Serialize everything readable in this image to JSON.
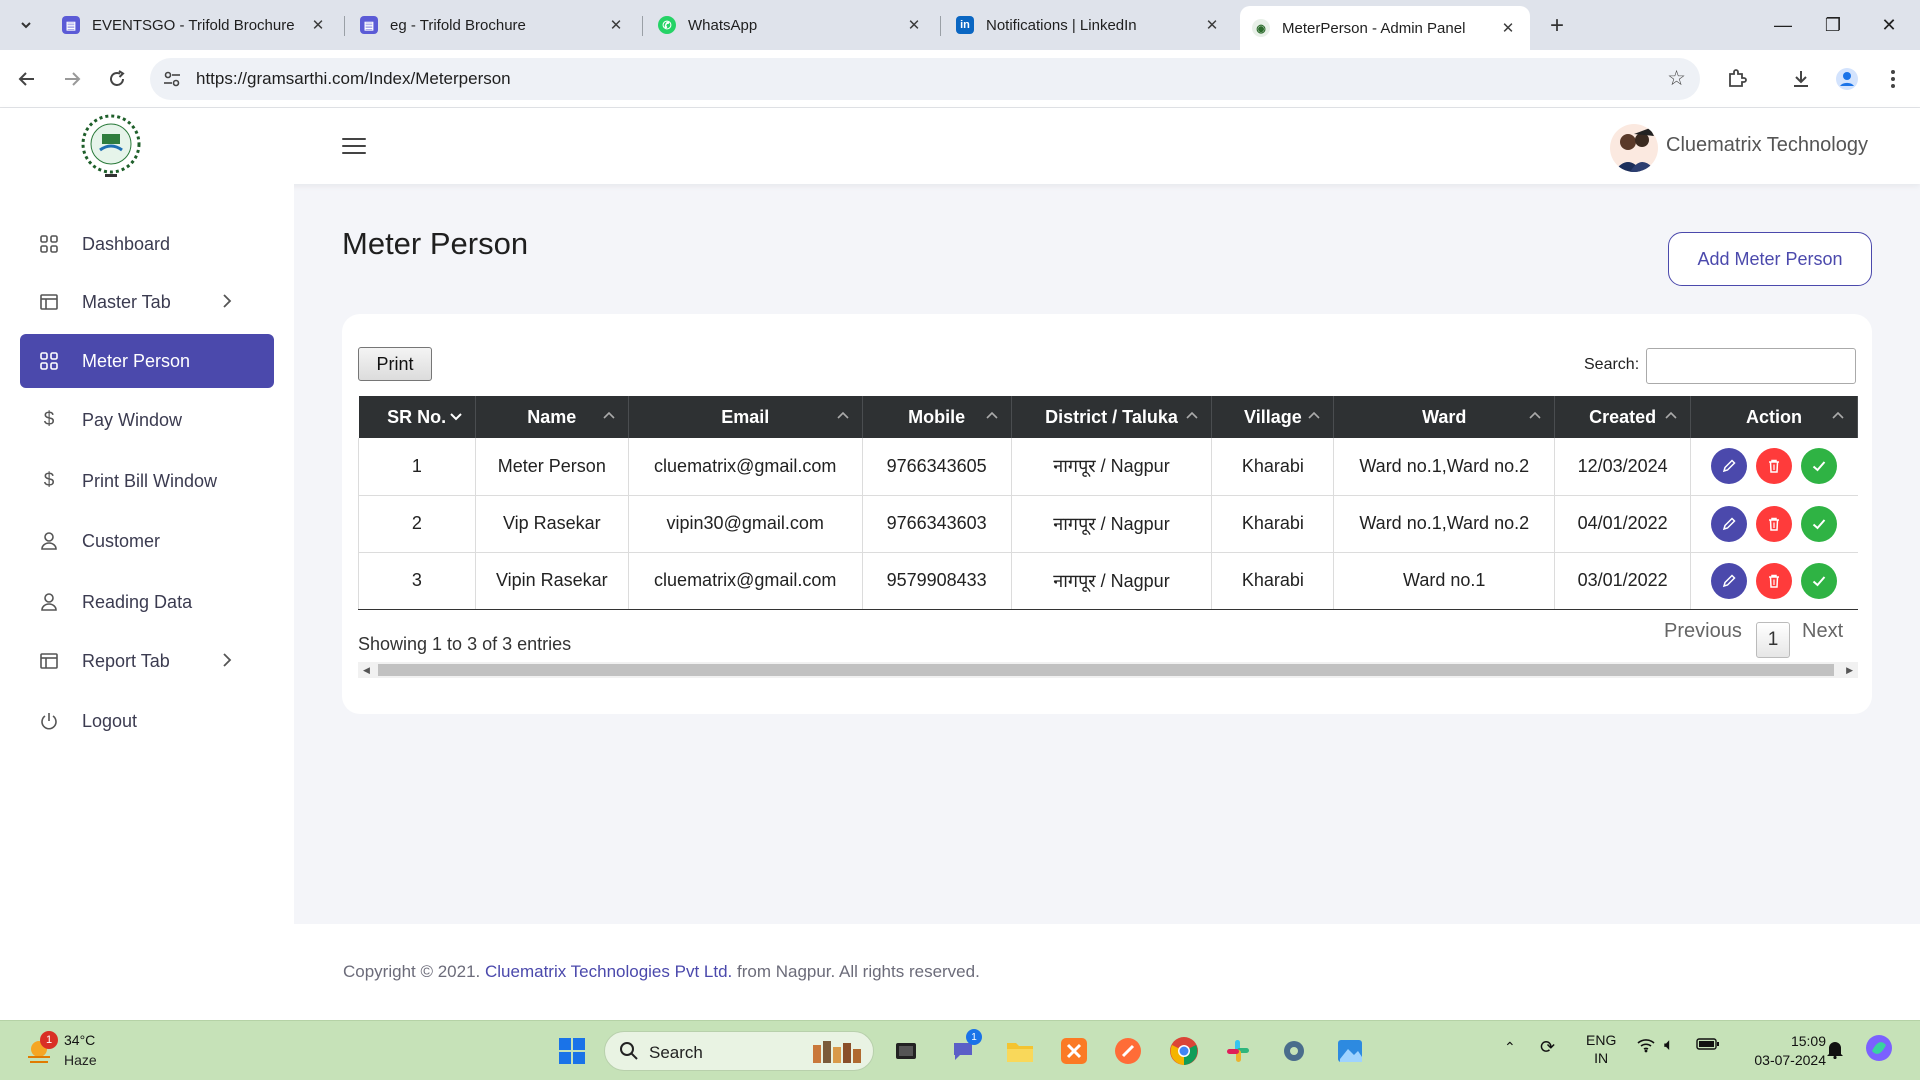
{
  "browser": {
    "tabs": [
      {
        "label": "EVENTSGO - Trifold Brochure"
      },
      {
        "label": "eg - Trifold Brochure"
      },
      {
        "label": "WhatsApp"
      },
      {
        "label": "Notifications | LinkedIn"
      },
      {
        "label": "MeterPerson - Admin Panel"
      }
    ],
    "url": "https://gramsarthi.com/Index/Meterperson"
  },
  "header": {
    "user_name": "Cluematrix Technology"
  },
  "sidebar": {
    "items": [
      {
        "label": "Dashboard",
        "icon": "grid-icon"
      },
      {
        "label": "Master Tab",
        "icon": "table-icon",
        "has_submenu": true
      },
      {
        "label": "Meter Person",
        "icon": "grid-icon",
        "active": true
      },
      {
        "label": "Pay Window",
        "icon": "dollar-icon"
      },
      {
        "label": "Print Bill Window",
        "icon": "dollar-icon"
      },
      {
        "label": "Customer",
        "icon": "user-icon"
      },
      {
        "label": "Reading Data",
        "icon": "user-icon"
      },
      {
        "label": "Report Tab",
        "icon": "table-icon",
        "has_submenu": true
      },
      {
        "label": "Logout",
        "icon": "power-icon"
      }
    ]
  },
  "main": {
    "title": "Meter Person",
    "add_button": "Add Meter Person",
    "print_button": "Print",
    "search_label": "Search:",
    "search_value": "",
    "table": {
      "headers": [
        "SR No.",
        "Name",
        "Email",
        "Mobile",
        "District / Taluka",
        "Village",
        "Ward",
        "Created",
        "Action"
      ],
      "rows": [
        {
          "sr": "1",
          "name": "Meter Person",
          "email": "cluematrix@gmail.com",
          "mobile": "9766343605",
          "district": "नागपूर / Nagpur",
          "village": "Kharabi",
          "ward": "Ward no.1,Ward no.2",
          "created": "12/03/2024"
        },
        {
          "sr": "2",
          "name": "Vip Rasekar",
          "email": "vipin30@gmail.com",
          "mobile": "9766343603",
          "district": "नागपूर / Nagpur",
          "village": "Kharabi",
          "ward": "Ward no.1,Ward no.2",
          "created": "04/01/2022"
        },
        {
          "sr": "3",
          "name": "Vipin Rasekar",
          "email": "cluematrix@gmail.com",
          "mobile": "9579908433",
          "district": "नागपूर / Nagpur",
          "village": "Kharabi",
          "ward": "Ward no.1",
          "created": "03/01/2022"
        }
      ]
    },
    "info": "Showing 1 to 3 of 3 entries",
    "pagination": {
      "previous": "Previous",
      "current": "1",
      "next": "Next"
    }
  },
  "footer": {
    "prefix": "Copyright © 2021. ",
    "link": "Cluematrix Technologies Pvt Ltd.",
    "suffix": " from Nagpur. All rights reserved."
  },
  "taskbar": {
    "weather_temp": "34°C",
    "weather_cond": "Haze",
    "weather_badge": "1",
    "search_label": "Search",
    "teams_badge": "1",
    "lang_line1": "ENG",
    "lang_line2": "IN",
    "time": "15:09",
    "date": "03-07-2024"
  },
  "colors": {
    "accent": "#4b49ac",
    "table_header": "#2e3133",
    "delete": "#ff3b3b",
    "approve": "#2fb344",
    "taskbar": "#c6e2b8"
  }
}
